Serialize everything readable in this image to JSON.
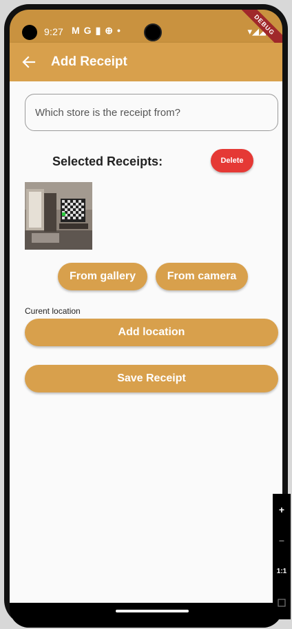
{
  "status_bar": {
    "time": "9:27",
    "left_icons": [
      "M",
      "G",
      "▮",
      "⊕",
      "•"
    ],
    "right_icons": "▾◢◢",
    "debug_label": "DEBUG"
  },
  "app_bar": {
    "title": "Add Receipt",
    "back_icon": "arrow-left-icon"
  },
  "form": {
    "store_placeholder": "Which store is the receipt from?",
    "store_value": ""
  },
  "receipts": {
    "title": "Selected Receipts:",
    "delete_label": "Delete",
    "images": [
      {
        "subject": "living room with tv"
      }
    ]
  },
  "image_source": {
    "gallery_label": "From gallery",
    "camera_label": "From camera"
  },
  "location": {
    "label": "Curent location",
    "add_label": "Add location"
  },
  "save_label": "Save Receipt",
  "zoom_controls": {
    "plus": "+",
    "minus": "−",
    "ratio": "1:1"
  },
  "colors": {
    "accent": "#d8a04c",
    "status_bar": "#c9923f",
    "delete": "#e53935",
    "background": "#fafafa"
  }
}
